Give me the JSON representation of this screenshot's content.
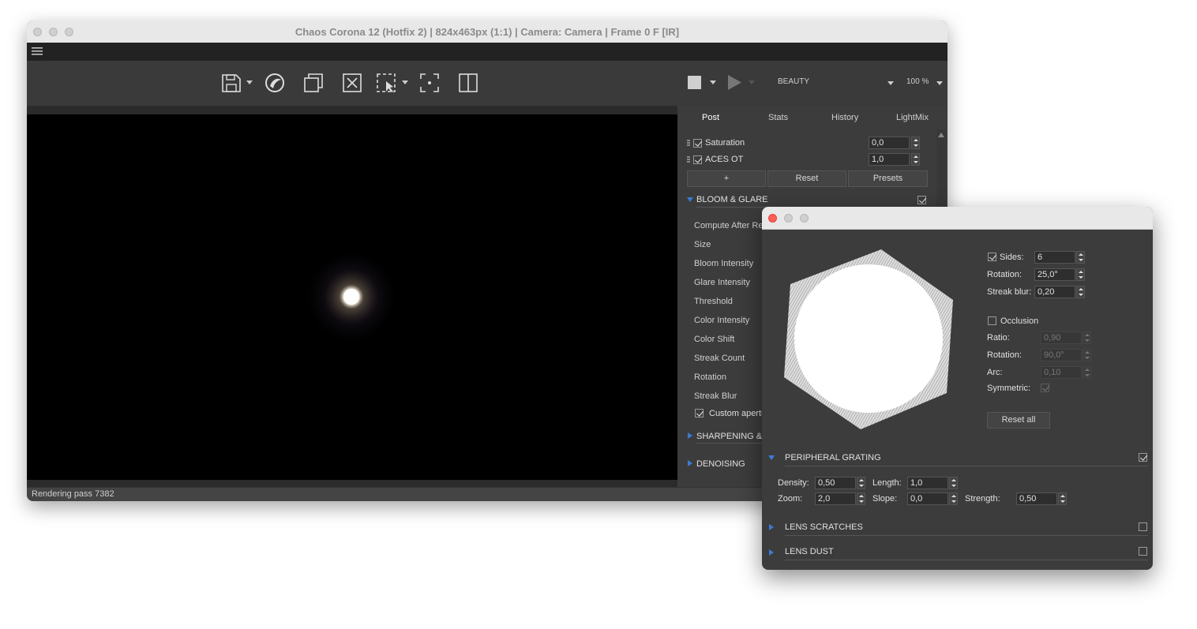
{
  "main_window": {
    "title": "Chaos Corona 12 (Hotfix 2) | 824x463px (1:1) | Camera: Camera | Frame 0 F [IR]",
    "toolbar": {
      "icons": [
        "save-icon",
        "corona-logo-icon",
        "duplicate-icon",
        "clear-icon",
        "region-select-icon",
        "center-focus-icon",
        "split-view-icon"
      ],
      "render_pass_label": "BEAUTY",
      "zoom": "100 %"
    },
    "tabs": [
      {
        "label": "Post",
        "active": true
      },
      {
        "label": "Stats",
        "active": false
      },
      {
        "label": "History",
        "active": false
      },
      {
        "label": "LightMix",
        "active": false
      }
    ],
    "post_ops": [
      {
        "label": "Saturation",
        "value": "0,0",
        "checked": true
      },
      {
        "label": "ACES OT",
        "value": "1,0",
        "checked": true
      }
    ],
    "buttons": {
      "add": "+",
      "reset": "Reset",
      "presets": "Presets"
    },
    "bloom_section": {
      "title": "BLOOM & GLARE",
      "enabled": true,
      "rows": [
        "Compute After Re",
        "Size",
        "Bloom Intensity",
        "Glare Intensity",
        "Threshold",
        "Color Intensity",
        "Color Shift",
        "Streak Count",
        "Rotation",
        "Streak Blur"
      ],
      "custom_aperture_label": "Custom apertu"
    },
    "sharpening_section": "SHARPENING & B",
    "denoising_section": "DENOISING",
    "status": "Rendering pass 7382"
  },
  "aperture_dialog": {
    "sides": {
      "label": "Sides:",
      "value": "6",
      "checked": true
    },
    "rotation": {
      "label": "Rotation:",
      "value": "25,0°"
    },
    "streak_blur": {
      "label": "Streak blur:",
      "value": "0,20"
    },
    "occlusion": {
      "label": "Occlusion",
      "checked": false,
      "ratio": {
        "label": "Ratio:",
        "value": "0,90"
      },
      "rotation": {
        "label": "Rotation:",
        "value": "90,0°"
      },
      "arc": {
        "label": "Arc:",
        "value": "0,10"
      },
      "symmetric": {
        "label": "Symmetric:",
        "checked": true
      }
    },
    "reset_all": "Reset all",
    "peripheral_grating": {
      "title": "PERIPHERAL GRATING",
      "enabled": true,
      "density": {
        "label": "Density:",
        "value": "0,50"
      },
      "length": {
        "label": "Length:",
        "value": "1,0"
      },
      "zoom": {
        "label": "Zoom:",
        "value": "2,0"
      },
      "slope": {
        "label": "Slope:",
        "value": "0,0"
      },
      "strength": {
        "label": "Strength:",
        "value": "0,50"
      }
    },
    "lens_scratches": {
      "title": "LENS SCRATCHES",
      "enabled": false
    },
    "lens_dust": {
      "title": "LENS DUST",
      "enabled": false
    }
  },
  "colors": {
    "accent": "#3a7bd5",
    "close_red": "#ff5f57"
  }
}
